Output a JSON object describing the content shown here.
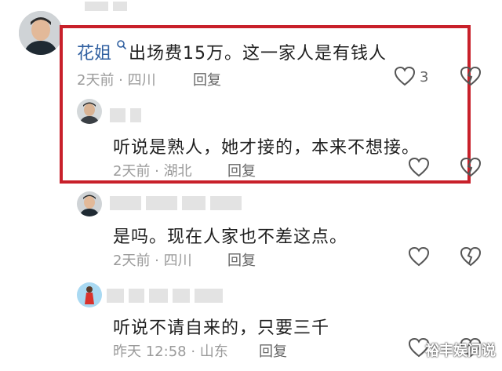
{
  "comments": [
    {
      "author": "花姐",
      "text": "出场费15万。这一家人是有钱人",
      "time": "2天前 · 四川",
      "reply": "回复",
      "likes": "3"
    },
    {
      "text": "听说是熟人，她才接的，本来不想接。",
      "time": "2天前 · 湖北",
      "reply": "回复"
    },
    {
      "text": "是吗。现在人家也不差这点。",
      "time": "2天前 · 四川",
      "reply": "回复"
    },
    {
      "text": "听说不请自来的，只要三千",
      "time": "昨天 12:58 · 山东",
      "reply": "回复"
    }
  ],
  "watermark": "裕丰娱间说",
  "colors": {
    "highlight": "#c8202a",
    "author": "#2f5fa0",
    "meta": "#9a9a9a"
  }
}
